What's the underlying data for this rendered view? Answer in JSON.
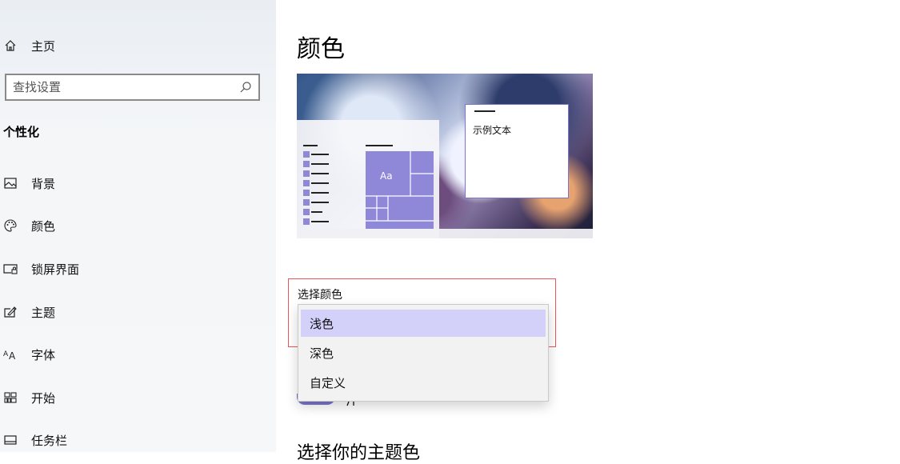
{
  "sidebar": {
    "home_label": "主页",
    "search": {
      "placeholder": "查找设置"
    },
    "section_title": "个性化",
    "items": [
      {
        "label": "背景",
        "icon": "image-icon"
      },
      {
        "label": "颜色",
        "icon": "palette-icon"
      },
      {
        "label": "锁屏界面",
        "icon": "lock-screen-icon"
      },
      {
        "label": "主题",
        "icon": "theme-brush-icon"
      },
      {
        "label": "字体",
        "icon": "font-icon"
      },
      {
        "label": "开始",
        "icon": "start-grid-icon"
      },
      {
        "label": "任务栏",
        "icon": "taskbar-icon"
      }
    ]
  },
  "main": {
    "title": "颜色",
    "preview": {
      "tile_label": "Aa",
      "sample_text": "示例文本"
    },
    "choose_color_label": "选择颜色",
    "next_section_title": "选择你的主题色"
  },
  "dropdown": {
    "options": [
      {
        "label": "浅色",
        "selected": true
      },
      {
        "label": "深色",
        "selected": false
      },
      {
        "label": "自定义",
        "selected": false
      }
    ]
  },
  "colors": {
    "accent": "#8f87d8",
    "selected_option": "#d3d0fa",
    "highlight_border": "#e8585a"
  }
}
